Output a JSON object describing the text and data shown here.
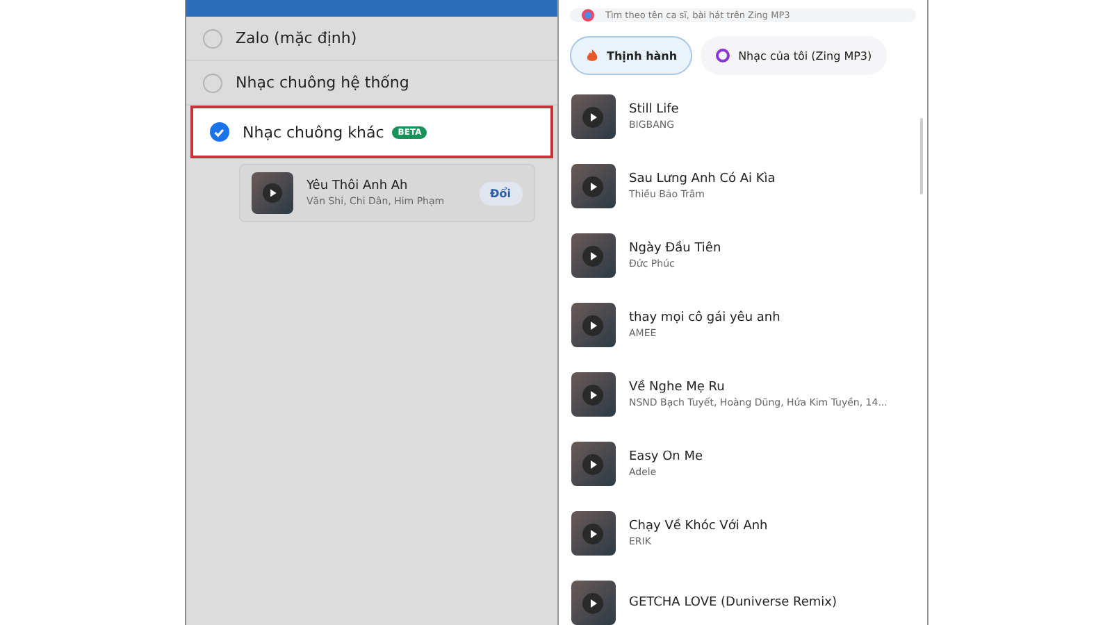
{
  "ringtone_settings": {
    "options": [
      {
        "label": "Zalo (mặc định)",
        "selected": false
      },
      {
        "label": "Nhạc chuông hệ thống",
        "selected": false
      },
      {
        "label": "Nhạc chuông khác",
        "badge": "BETA",
        "selected": true
      }
    ],
    "current_song": {
      "title": "Yêu Thôi Anh Ah",
      "artists": "Văn Shi, Chi Dân, Him Phạm",
      "button": "Đổi"
    }
  },
  "song_picker": {
    "search": {
      "placeholder": "Tìm theo tên ca sĩ, bài hát trên Zing MP3"
    },
    "tabs": [
      {
        "label": "Thịnh hành",
        "selected": true
      },
      {
        "label": "Nhạc của tôi (Zing MP3)",
        "selected": false
      }
    ],
    "songs": [
      {
        "title": "Still Life",
        "artist": "BIGBANG"
      },
      {
        "title": "Sau Lưng Anh Có Ai Kìa",
        "artist": "Thiều Bảo Trâm"
      },
      {
        "title": "Ngày Đầu Tiên",
        "artist": "Đức Phúc"
      },
      {
        "title": "thay mọi cô gái yêu anh",
        "artist": "AMEE"
      },
      {
        "title": "Về Nghe Mẹ Ru",
        "artist": "NSND Bạch Tuyết, Hoàng Dũng, Hứa Kim Tuyền, 14..."
      },
      {
        "title": "Easy On Me",
        "artist": "Adele"
      },
      {
        "title": "Chạy Về Khóc Với Anh",
        "artist": "ERIK"
      },
      {
        "title": "GETCHA LOVE (Duniverse Remix)"
      }
    ]
  }
}
